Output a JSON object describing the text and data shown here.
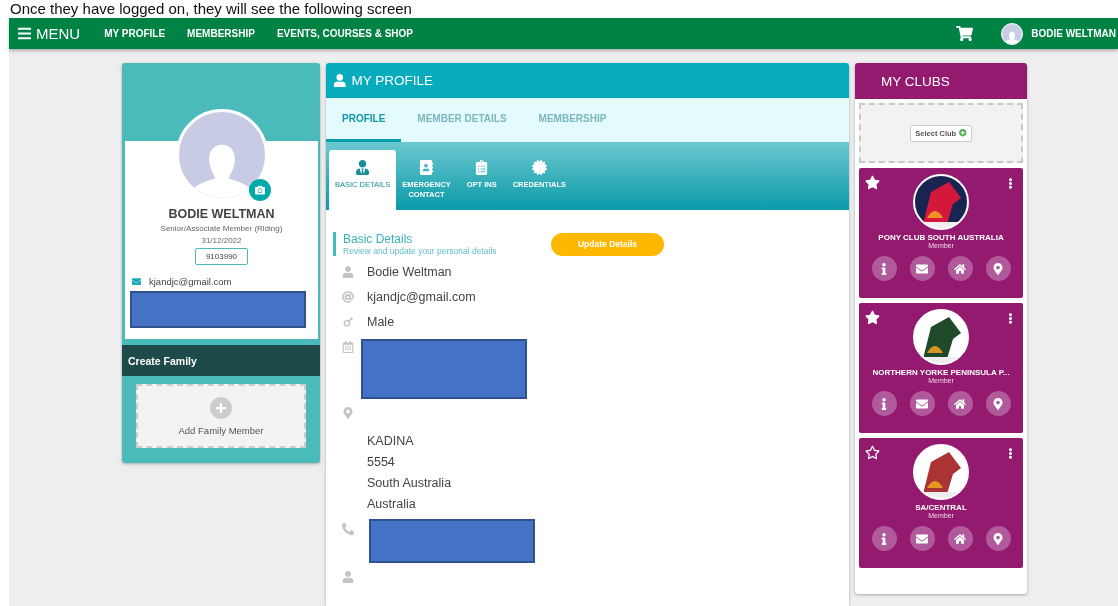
{
  "caption": "Once they have logged on, they will see the following screen",
  "nav": {
    "menu_icon_label": "MENU",
    "links": [
      "MY PROFILE",
      "MEMBERSHIP",
      "EVENTS, COURSES & SHOP"
    ],
    "user": "BODIE WELTMAN"
  },
  "profile_card": {
    "name": "BODIE WELTMAN",
    "membership": "Senior/Associate Member (Riding)",
    "expiry": "31/12/2022",
    "member_number": "9103990",
    "email": "kjandjc@gmail.com",
    "family_title": "Create Family",
    "add_family": "Add Family Member"
  },
  "main": {
    "title": "MY PROFILE",
    "tabs": [
      {
        "label": "PROFILE",
        "selected": true
      },
      {
        "label": "MEMBER DETAILS",
        "selected": false
      },
      {
        "label": "MEMBERSHIP",
        "selected": false
      }
    ],
    "subtabs": [
      {
        "label": "BASIC DETAILS",
        "kind": "person",
        "selected": true
      },
      {
        "label": "EMERGENCY\nCONTACT",
        "kind": "contact",
        "selected": false
      },
      {
        "label": "OPT INS",
        "kind": "list",
        "selected": false
      },
      {
        "label": "CREDENTIALS",
        "kind": "badge",
        "selected": false
      }
    ],
    "section_title": "Basic Details",
    "section_subtitle": "Review and update your personal details",
    "update_button": "Update Details",
    "details": [
      {
        "kind": "person",
        "lines": [
          "Bodie Weltman"
        ]
      },
      {
        "kind": "email",
        "lines": [
          "kjandjc@gmail.com"
        ]
      },
      {
        "kind": "gender",
        "lines": [
          "Male"
        ]
      },
      {
        "kind": "calendar"
      },
      {
        "kind": "location",
        "lines": [
          "KADINA",
          "5554",
          "South Australia",
          "Australia"
        ]
      },
      {
        "kind": "phone"
      },
      {
        "kind": "person"
      }
    ]
  },
  "clubs": {
    "title": "MY CLUBS",
    "select_button": "Select Club",
    "items": [
      {
        "name": "PONY CLUB SOUTH AUSTRALIA",
        "role": "Member",
        "favorite": true
      },
      {
        "name": "NORTHERN YORKE PENINSULA P...",
        "role": "Member",
        "favorite": true
      },
      {
        "name": "SA/CENTRAL",
        "role": "Member",
        "favorite": false
      }
    ]
  }
}
